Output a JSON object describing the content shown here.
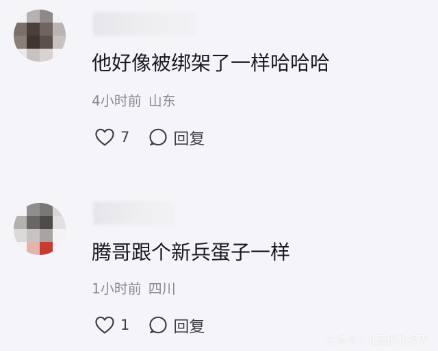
{
  "comments": [
    {
      "username": "",
      "text": "他好像被绑架了一样哈哈哈",
      "time": "4小时前",
      "location": "山东",
      "likes": "7",
      "reply_label": "回复",
      "avatar_colors": [
        "#f3f3f5",
        "#b7b2b2",
        "#8e8886",
        "#f3f3f5",
        "#7b6f6a",
        "#4a3f3b",
        "#6f6460",
        "#b9b3b1",
        "#8a7e79",
        "#3e3430",
        "#5c504c",
        "#c7c1bf",
        "#e9e9ec",
        "#c9c2c0",
        "#d8d3d2",
        "#f3f3f5"
      ]
    },
    {
      "username": "",
      "text": "腾哥跟个新兵蛋子一样",
      "time": "1小时前",
      "location": "四川",
      "likes": "1",
      "reply_label": "回复",
      "avatar_colors": [
        "#f3f3f5",
        "#8f8d8d",
        "#7a7777",
        "#d8d6d6",
        "#b3b0b0",
        "#6b6767",
        "#4f4b4b",
        "#e2e0e0",
        "#dcd9d9",
        "#c7c3c3",
        "#a9a4a4",
        "#f3f3f5",
        "#f3f3f5",
        "#e3b3ad",
        "#c93b2f",
        "#f3f3f5"
      ]
    }
  ],
  "icons": {
    "like": "heart-outline-icon",
    "reply": "speech-bubble-icon"
  },
  "watermark": "头条号 / 北辰的新视界"
}
